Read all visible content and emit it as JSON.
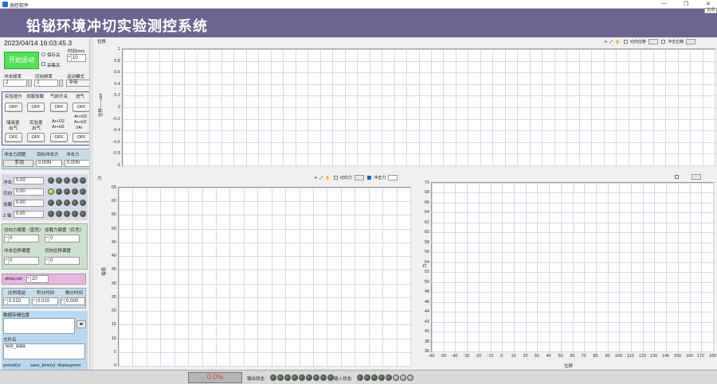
{
  "window": {
    "title": "测控软件",
    "close_label": "关闭",
    "minimize": "—",
    "restore": "❐",
    "close_x": "✕"
  },
  "header": {
    "title": "铅铋环境冲切实验测控系统"
  },
  "left": {
    "datetime": "2023/04/14 16:03:45.3",
    "start_button": "开始运动",
    "save_label": "保存关",
    "collect_label": "采集关",
    "time_label": "时间/min",
    "time_value": "10",
    "impact_freq_label": "冲击频率",
    "impact_freq_value": "2",
    "cut_freq_label": "切向频率",
    "cut_freq_value": "2",
    "motion_mode_label": "运动模式",
    "motion_mode_value": "冲击",
    "switches_row1": [
      {
        "label": "实验提升",
        "state": "OFF"
      },
      {
        "label": "伺服加载",
        "state": "OFF"
      },
      {
        "label": "气体开关",
        "state": "OFF"
      },
      {
        "label": "进气",
        "state": "OFF"
      }
    ],
    "switches_row2": [
      {
        "label1": "储液釜",
        "label2": "出气",
        "state": "OFF"
      },
      {
        "label1": "实验釜",
        "label2": "出气",
        "state": "OFF"
      },
      {
        "label1": "Ar+O2",
        "label2": "Ar+H2",
        "state": "OFF"
      },
      {
        "label1": "Ar+O2",
        "label2": "Ar+H2",
        "label3": "//Ar",
        "state": "OFF"
      }
    ],
    "impact_adjust_label": "冲击力调整",
    "impact_adjust_value": "手动",
    "target_force_label": "目标冲击力",
    "target_force_value": "0.00N",
    "impact_force_label": "冲击力",
    "impact_force_value": "0.00N",
    "axes": [
      {
        "label": "冲击",
        "value": "0.00",
        "leds": [
          false,
          false,
          false,
          false,
          false
        ]
      },
      {
        "label": "切向",
        "value": "0.00",
        "leds": [
          true,
          false,
          false,
          false,
          false
        ]
      },
      {
        "label": "加载",
        "value": "0.00",
        "leds": [
          false,
          false,
          false,
          false,
          false
        ]
      },
      {
        "label": "Z 轴",
        "value": "0.00",
        "leds": [
          false,
          false,
          false,
          false,
          false
        ]
      }
    ],
    "cut_offset_label": "切向力偏置（蓝色）",
    "cut_offset_value": "0",
    "load_offset_label": "加载力偏置（红色）",
    "load_offset_value": "0",
    "impact_disp_offset_label": "冲击位移偏置",
    "impact_disp_offset_value": "0",
    "cut_disp_offset_label": "切向位移偏置",
    "cut_disp_offset_value": "0",
    "delay_label": "delay.set",
    "delay_value": "20",
    "p_label": "比例增益",
    "p_value": "0.010",
    "i_label": "积分时间",
    "i_value": "0.010",
    "d_label": "微分时间",
    "d_value": "0.000",
    "storage_label": "数据存储位置",
    "storage_value": "",
    "filename_label": "文件名",
    "filename_value": "test_data",
    "bottom_labels": [
      "period(s)",
      "save_time(s)",
      "displaypoint"
    ]
  },
  "top_chart": {
    "y_label": "位移",
    "y_axis_label": "位移——um",
    "toolbar": {
      "legend1": "切向位移",
      "legend2": "冲击位移"
    },
    "y_ticks": [
      "1",
      "0.8",
      "0.6",
      "0.4",
      "0.2",
      "0",
      "-0.2",
      "-0.4",
      "-0.6",
      "-0.8",
      "-1"
    ]
  },
  "force_chart": {
    "title": "力",
    "y_axis_label": "幅值",
    "toolbar": {
      "legend1": "切向力",
      "legend2": "冲击力"
    },
    "y_ticks": [
      "65",
      "60",
      "55",
      "50",
      "45",
      "40",
      "35",
      "30",
      "25",
      "20",
      "15",
      "10",
      "5",
      "0"
    ]
  },
  "xy_chart": {
    "y_label": "力",
    "x_label": "位移",
    "y_ticks": [
      "70",
      "68",
      "66",
      "64",
      "62",
      "60",
      "58",
      "56",
      "54",
      "52",
      "50",
      "48",
      "46",
      "44",
      "42",
      "40",
      "38",
      "36"
    ],
    "x_ticks": [
      "-60",
      "-50",
      "-40",
      "-30",
      "-20",
      "-10",
      "0",
      "10",
      "20",
      "30",
      "40",
      "50",
      "60",
      "70",
      "80",
      "90",
      "100",
      "110",
      "120",
      "130",
      "140",
      "150",
      "160",
      "170",
      "180"
    ]
  },
  "status": {
    "progress": "0.0%",
    "output_label": "输出状态",
    "input_label": "输入状态",
    "output_leds": [
      false,
      false,
      false,
      false,
      false,
      false,
      false,
      false,
      false
    ],
    "input_leds": [
      false,
      false,
      false,
      false,
      false,
      false,
      false,
      false
    ]
  },
  "colors": {
    "banner": "#6b6690",
    "led_on": "#5ccc20",
    "progress_text": "#e04040",
    "force_blue": "#1f5fbf"
  }
}
